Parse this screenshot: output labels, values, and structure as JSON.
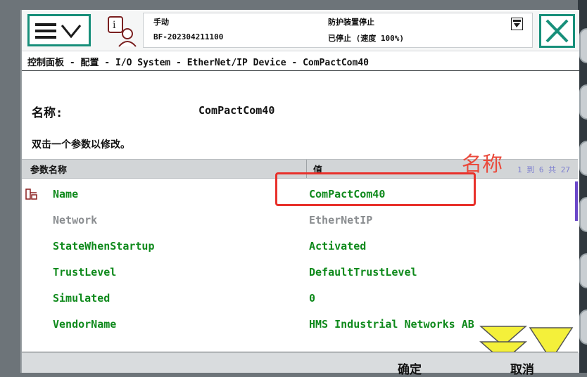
{
  "header": {
    "mode": "手动",
    "controller": "BF-202304211100",
    "status_line1": "防护装置停止",
    "status_line2": "已停止 (速度 100%)"
  },
  "breadcrumb": "控制面板 - 配置 - I/O System - EtherNet/IP Device - ComPactCom40",
  "name_label": "名称:",
  "name_value": "ComPactCom40",
  "hint": "双击一个参数以修改。",
  "table": {
    "col_param": "参数名称",
    "col_value": "值",
    "page_info": "1 到 6 共 27",
    "rows": [
      {
        "param": "Name",
        "value": "ComPactCom40"
      },
      {
        "param": "Network",
        "value": "EtherNetIP"
      },
      {
        "param": "StateWhenStartup",
        "value": "Activated"
      },
      {
        "param": "TrustLevel",
        "value": "DefaultTrustLevel"
      },
      {
        "param": "Simulated",
        "value": "0"
      },
      {
        "param": "VendorName",
        "value": "HMS Industrial Networks AB"
      }
    ]
  },
  "annotation": "名称",
  "buttons": {
    "ok": "确定",
    "cancel": "取消"
  },
  "colors": {
    "accent": "#178f7a",
    "param_text": "#0f8a1c",
    "highlight": "#e8312b",
    "disabled_text": "#8a8d90"
  }
}
